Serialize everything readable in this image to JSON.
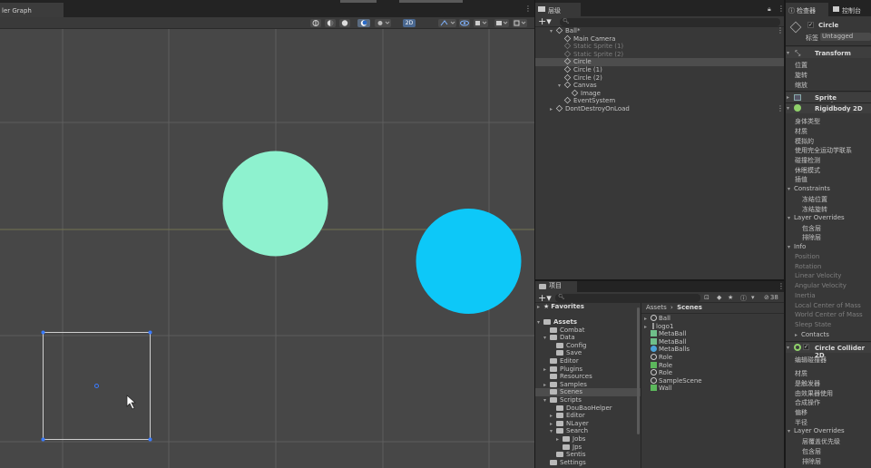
{
  "scene_view": {
    "tab_label": "ler Graph",
    "toolbar_2d_label": "2D"
  },
  "hierarchy": {
    "tab_label": "层级",
    "items": [
      {
        "label": "Ball*",
        "state": "normal"
      },
      {
        "label": "Main Camera",
        "state": "normal"
      },
      {
        "label": "Static Sprite (1)",
        "state": "disabled"
      },
      {
        "label": "Static Sprite (2)",
        "state": "disabled"
      },
      {
        "label": "Circle",
        "state": "selected"
      },
      {
        "label": "Circle (1)",
        "state": "normal"
      },
      {
        "label": "Circle (2)",
        "state": "normal"
      },
      {
        "label": "Canvas",
        "state": "normal"
      },
      {
        "label": "Image",
        "state": "normal"
      },
      {
        "label": "EventSystem",
        "state": "normal"
      },
      {
        "label": "DontDestroyOnLoad",
        "state": "normal"
      }
    ]
  },
  "project": {
    "tab_label": "项目",
    "hidden_count": "38",
    "favorites_label": "Favorites",
    "tree": [
      {
        "label": "Assets"
      },
      {
        "label": "Combat"
      },
      {
        "label": "Data"
      },
      {
        "label": "Config"
      },
      {
        "label": "Save"
      },
      {
        "label": "Editor"
      },
      {
        "label": "Plugins"
      },
      {
        "label": "Resources"
      },
      {
        "label": "Samples"
      },
      {
        "label": "Scenes"
      },
      {
        "label": "Scripts"
      },
      {
        "label": "DouBaoHelper"
      },
      {
        "label": "Editor"
      },
      {
        "label": "NLayer"
      },
      {
        "label": "Search"
      },
      {
        "label": "Jobs"
      },
      {
        "label": "Jps"
      },
      {
        "label": "Sentis"
      },
      {
        "label": "Settings"
      }
    ],
    "breadcrumb": {
      "root": "Assets",
      "separator": "›",
      "current": "Scenes"
    },
    "files": [
      {
        "label": "Ball",
        "icon": "unity-scene-icon"
      },
      {
        "label": "logo1",
        "icon": "prefab-icon"
      },
      {
        "label": "MetaBall",
        "icon": "material-icon"
      },
      {
        "label": "MetaBall",
        "icon": "material-icon"
      },
      {
        "label": "MetaBalls",
        "icon": "shader-icon"
      },
      {
        "label": "Role",
        "icon": "unity-scene-icon"
      },
      {
        "label": "Role",
        "icon": "script-icon"
      },
      {
        "label": "Role",
        "icon": "unity-scene-icon"
      },
      {
        "label": "SampleScene",
        "icon": "unity-scene-icon"
      },
      {
        "label": "Wall",
        "icon": "script-icon"
      }
    ]
  },
  "inspector": {
    "tab_inspector": "检查器",
    "tab_console": "控制台",
    "object_name": "Circle",
    "tag_label": "标签",
    "tag_value": "Untagged",
    "transform": {
      "title": "Transform",
      "fields": [
        "位置",
        "旋转",
        "缩放"
      ]
    },
    "sprite_renderer": {
      "title": "Sprite Renderer"
    },
    "rigidbody": {
      "title": "Rigidbody 2D",
      "fields": [
        "身体类型",
        "材质",
        "模拟的",
        "使用完全运动学联系",
        "碰撞检测",
        "休眠模式",
        "插值"
      ],
      "constraints_label": "Constraints",
      "constraints": [
        "冻结位置",
        "冻结旋转"
      ],
      "layer_overrides_label": "Layer Overrides",
      "layer_fields": [
        "包含层",
        "排除层"
      ],
      "info_label": "Info",
      "info_fields": [
        "Position",
        "Rotation",
        "Linear Velocity",
        "Angular Velocity",
        "Inertia",
        "Local Center of Mass",
        "World Center of Mass",
        "Sleep State"
      ],
      "contacts_label": "Contacts"
    },
    "circle_collider": {
      "title": "Circle Collider 2D",
      "fields": [
        "编辑碰撞器",
        "材质",
        "是触发器",
        "由效果器使用",
        "合成操作",
        "偏移",
        "半径"
      ],
      "layer_overrides_label": "Layer Overrides",
      "layer_fields": [
        "层覆盖优先级",
        "包含层",
        "排除层"
      ]
    }
  },
  "colors": {
    "scene_bg": "#474747",
    "green_circle": "#8ef2cf",
    "blue_circle": "#0dc8f8",
    "selection_handle": "#3a7bff",
    "panel_bg": "#383838"
  }
}
